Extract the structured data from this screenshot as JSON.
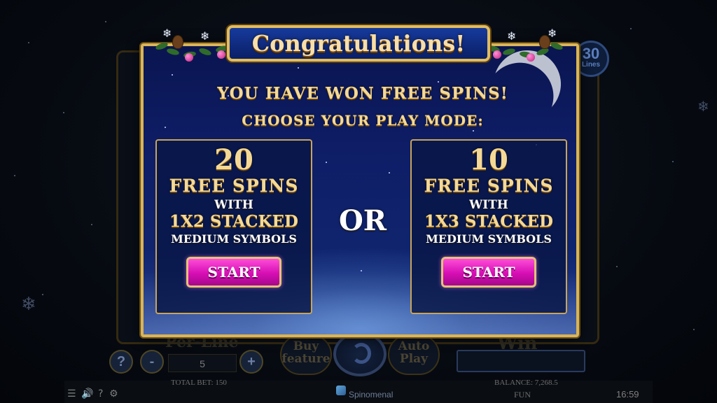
{
  "popup": {
    "title": "Congratulations!",
    "line1": "YOU HAVE WON FREE SPINS!",
    "line2": "CHOOSE YOUR PLAY MODE:",
    "or_text": "OR",
    "options": [
      {
        "count": "20",
        "spins_label": "FREE SPINS",
        "with": "WITH",
        "stacked": "1X2 STACKED",
        "medium": "MEDIUM SYMBOLS",
        "start_label": "START"
      },
      {
        "count": "10",
        "spins_label": "FREE SPINS",
        "with": "WITH",
        "stacked": "1X3 STACKED",
        "medium": "MEDIUM SYMBOLS",
        "start_label": "START"
      }
    ]
  },
  "background": {
    "lines_count": "30",
    "lines_label": "Lines",
    "per_line_label": "Per-Line",
    "per_line_value": "5",
    "win_label": "Win",
    "buy_feature_label": "Buy feature",
    "auto_play_label": "Auto Play",
    "help_symbol": "?",
    "minus_symbol": "-",
    "plus_symbol": "+"
  },
  "statusbar": {
    "total_bet": "TOTAL BET: 150",
    "balance": "BALANCE: 7,268.5",
    "brand": "Spinomenal",
    "mode": "FUN",
    "clock": "16:59"
  },
  "colors": {
    "popup_border": "#d9b55a",
    "gold_text": "#f4d996",
    "start_button": "#d60eb4",
    "popup_background": "#0e1d66"
  }
}
